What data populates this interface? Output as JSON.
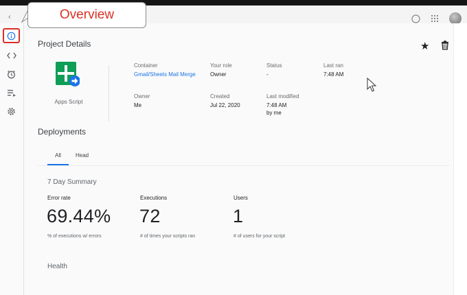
{
  "callout": {
    "text": "Overview"
  },
  "project": {
    "heading": "Project Details",
    "app_label": "Apps Script",
    "fields": {
      "container": {
        "label": "Container",
        "value": "Gmail/Sheets Mail Merge"
      },
      "role": {
        "label": "Your role",
        "value": "Owner"
      },
      "status": {
        "label": "Status",
        "value": "-"
      },
      "last_ran": {
        "label": "Last ran",
        "value": "7:48 AM"
      },
      "owner": {
        "label": "Owner",
        "value": "Me"
      },
      "created": {
        "label": "Created",
        "value": "Jul 22, 2020"
      },
      "modified": {
        "label": "Last modified",
        "value": "7:48 AM",
        "value2": "by me"
      }
    }
  },
  "deployments": {
    "heading": "Deployments",
    "tabs": [
      {
        "label": "All"
      },
      {
        "label": "Head"
      }
    ]
  },
  "summary": {
    "heading": "7 Day Summary",
    "metrics": [
      {
        "label": "Error rate",
        "value": "69.44%",
        "desc": "% of executions w/ errors"
      },
      {
        "label": "Executions",
        "value": "72",
        "desc": "# of times your scripts ran"
      },
      {
        "label": "Users",
        "value": "1",
        "desc": "# of users for your script"
      }
    ]
  },
  "health": {
    "heading": "Health"
  },
  "colors": {
    "accent": "#1a73e8",
    "highlight": "#d93025",
    "icon_green": "#0f9d58"
  }
}
